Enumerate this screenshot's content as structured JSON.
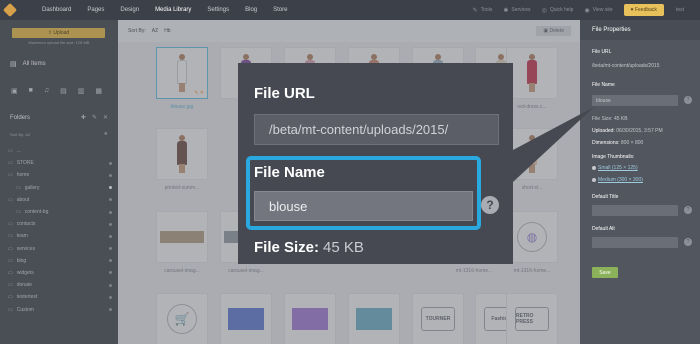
{
  "topnav": {
    "items": [
      "Dashboard",
      "Pages",
      "Design",
      "Media Library",
      "Settings",
      "Blog",
      "Store"
    ],
    "active_index": 3,
    "tools": [
      {
        "icon": "wrench-icon",
        "label": "Tools"
      },
      {
        "icon": "puzzle-icon",
        "label": "Services"
      },
      {
        "icon": "lifebuoy-icon",
        "label": "Quick help"
      },
      {
        "icon": "eye-icon",
        "label": "View site"
      }
    ],
    "feedback_label": "Feedback",
    "user_label": "test"
  },
  "sidebar": {
    "upload_label": "Upload",
    "upload_note": "Maximum upload file size: 128 MB",
    "all_items_label": "All Items",
    "folders_title": "Folders",
    "sort_by_label": "Sort By:",
    "sort_by_value": "AZ",
    "folders": [
      {
        "label": "...",
        "sub": false,
        "dot": "none"
      },
      {
        "label": "STORE",
        "sub": false,
        "dot": "grey"
      },
      {
        "label": "home",
        "sub": false,
        "dot": "grey"
      },
      {
        "label": "gallery",
        "sub": true,
        "dot": "white"
      },
      {
        "label": "about",
        "sub": false,
        "dot": "grey"
      },
      {
        "label": "content-bg",
        "sub": true,
        "dot": "grey"
      },
      {
        "label": "contacts",
        "sub": false,
        "dot": "grey"
      },
      {
        "label": "team",
        "sub": false,
        "dot": "grey"
      },
      {
        "label": "services",
        "sub": false,
        "dot": "grey"
      },
      {
        "label": "blog",
        "sub": false,
        "dot": "grey"
      },
      {
        "label": "widgets",
        "sub": false,
        "dot": "grey"
      },
      {
        "label": "donate",
        "sub": false,
        "dot": "grey"
      },
      {
        "label": "testertest",
        "sub": false,
        "dot": "grey"
      },
      {
        "label": "Custom",
        "sub": false,
        "dot": "grey"
      }
    ]
  },
  "sortbar": {
    "label": "Sort By:",
    "options": [
      "AZ",
      "Hb"
    ],
    "delete_label": "Delete"
  },
  "grid": {
    "row1": [
      {
        "label": "blouse.jpg",
        "selected": true,
        "color": "#f3f4f6"
      },
      {
        "label": "",
        "selected": false,
        "color": "#8b5aa6"
      },
      {
        "label": "",
        "selected": false,
        "color": "#d9a7b6"
      },
      {
        "label": "",
        "selected": false,
        "color": "#c98f7c"
      },
      {
        "label": "",
        "selected": false,
        "color": "#9fb7c6"
      },
      {
        "label": "",
        "selected": false,
        "color": "#e1d3c5"
      },
      {
        "label": "red-dress.c...",
        "selected": false,
        "color": "#c84b63"
      }
    ],
    "row2": [
      {
        "label": "printed-summ...",
        "selected": false,
        "color": "#7b5e5a"
      },
      {
        "label": "short-sl...",
        "selected": false,
        "color": "#e7c8b3"
      }
    ],
    "row3": [
      {
        "label": "carousel-imag...",
        "kind": "strip",
        "color": "#b7a58f"
      },
      {
        "label": "carousel-imag...",
        "kind": "strip",
        "color": "#9aa4ad"
      },
      {
        "label": "mt-1316-home...",
        "kind": "circle",
        "color": "#9c8bd2"
      },
      {
        "label": "mt-1316-home...",
        "kind": "circle",
        "color": "#9c8bd2"
      }
    ],
    "row4": [
      {
        "kind": "circle",
        "glyph": "🛒"
      },
      {
        "kind": "swatch",
        "color": "#6e86d8"
      },
      {
        "kind": "swatch",
        "color": "#a887d8"
      },
      {
        "kind": "swatch",
        "color": "#79b4c9"
      },
      {
        "kind": "badge",
        "text": "TOURNER"
      },
      {
        "kind": "badge",
        "text": "Fashion"
      },
      {
        "kind": "badge",
        "text": "RETRO PRESS"
      }
    ]
  },
  "rpanel": {
    "title": "File Properties",
    "url_label": "File URL",
    "url_value": "/beta/mt-content/uploads/2015",
    "name_label": "File Name",
    "name_value": "blouse",
    "size_label": "File Size:",
    "size_value": "45 KB",
    "uploaded_label": "Uploaded:",
    "uploaded_value": "06/30/2015, 3:57 PM",
    "dimensions_label": "Dimensions:",
    "dimensions_value": "800 × 800",
    "thumbs_label": "Image Thumbnails:",
    "thumb_small": "Small (125 × 125)",
    "thumb_medium": "Medium (300 × 300)",
    "default_title_label": "Default Title",
    "default_alt_label": "Default Alt",
    "save_label": "Save"
  },
  "zoom": {
    "url_label": "File URL",
    "url_value": "/beta/mt-content/uploads/2015/",
    "name_label": "File Name",
    "name_value": "blouse",
    "help_glyph": "?",
    "size_label": "File Size:",
    "size_value": "45 KB"
  }
}
